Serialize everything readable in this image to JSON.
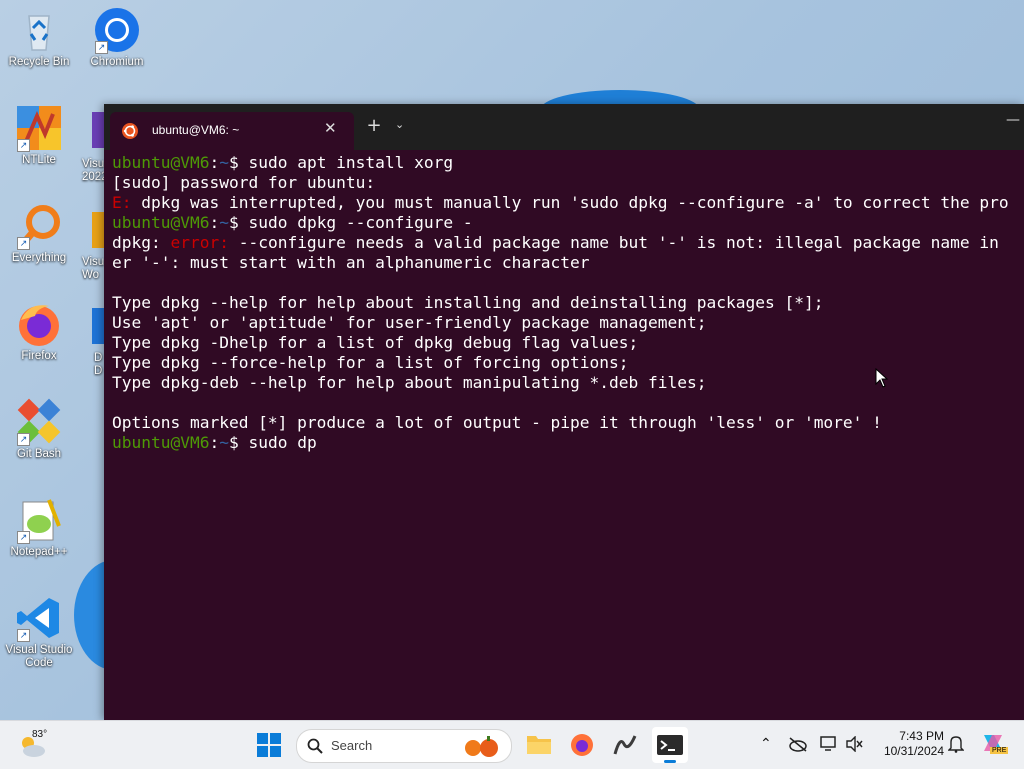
{
  "desktop": {
    "icons": [
      {
        "label": "Recycle Bin",
        "icon": "recycle-bin-icon"
      },
      {
        "label": "Chromium",
        "icon": "chromium-icon"
      },
      {
        "label": "NTLite",
        "icon": "ntlite-icon"
      },
      {
        "label": "Everything",
        "icon": "everything-search-icon"
      },
      {
        "label": "Firefox",
        "icon": "firefox-icon"
      },
      {
        "label": "Git Bash",
        "icon": "git-bash-icon"
      },
      {
        "label": "Notepad++",
        "icon": "notepad-plus-plus-icon"
      },
      {
        "label": "Visual Studio Code",
        "icon": "vscode-icon"
      }
    ],
    "partial_labels": [
      "Visu",
      "2022",
      "Visu",
      "Wo",
      "D",
      "D"
    ]
  },
  "terminal": {
    "tab_title": "ubuntu@VM6: ~",
    "tab_close": "✕",
    "new_tab": "+",
    "dropdown": "⌄",
    "minimize": "—",
    "prompt_user": "ubuntu@VM6",
    "prompt_sep": ":",
    "prompt_path": "~",
    "prompt_dollar": "$ ",
    "cmd1": "sudo apt install xorg",
    "line_sudo": "[sudo] password for ubuntu:",
    "err_prefix": "E:",
    "err_msg": " dpkg was interrupted, you must manually run 'sudo dpkg --configure -a' to correct the pro",
    "cmd2": "sudo dpkg --configure -",
    "dpkg_prefix": "dpkg: ",
    "dpkg_error": "error:",
    "dpkg_msg1": " --configure needs a valid package name but '-' is not: illegal package name in",
    "dpkg_msg2": "er '-': must start with an alphanumeric character",
    "help1": "Type dpkg --help for help about installing and deinstalling packages [*];",
    "help2": "Use 'apt' or 'aptitude' for user-friendly package management;",
    "help3": "Type dpkg -Dhelp for a list of dpkg debug flag values;",
    "help4": "Type dpkg --force-help for a list of forcing options;",
    "help5": "Type dpkg-deb --help for help about manipulating *.deb files;",
    "options": "Options marked [*] produce a lot of output - pipe it through 'less' or 'more' !",
    "cmd3": "sudo dp"
  },
  "taskbar": {
    "weather_temp": "83°",
    "search_placeholder": "Search",
    "time": "7:43 PM",
    "date": "10/31/2024",
    "copilot_badge": "PRE"
  },
  "colors": {
    "terminal_bg": "#300a24",
    "prompt_user": "#4e9a06",
    "prompt_path": "#3465a4",
    "error": "#cc0000"
  }
}
